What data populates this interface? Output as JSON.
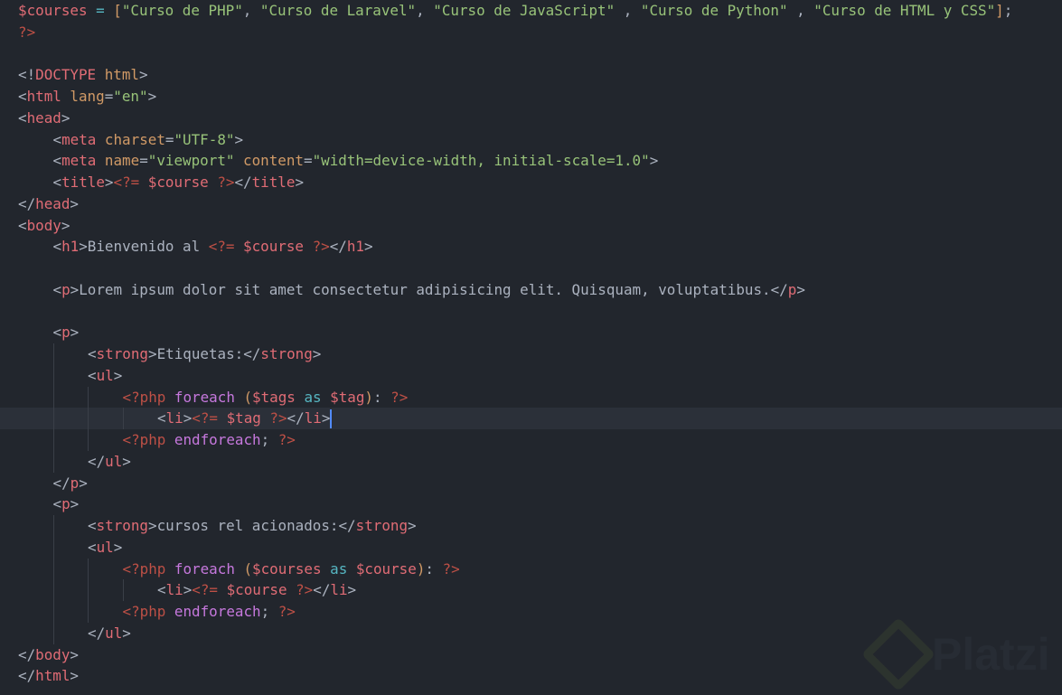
{
  "editor": {
    "active_line": 20,
    "lines": [
      {
        "indent": 0,
        "tokens": [
          [
            "v",
            "$courses"
          ],
          [
            "o",
            " = "
          ],
          [
            "b",
            "["
          ],
          [
            "s",
            "\"Curso de PHP\""
          ],
          [
            "n",
            ", "
          ],
          [
            "s",
            "\"Curso de Laravel\""
          ],
          [
            "n",
            ", "
          ],
          [
            "s",
            "\"Curso de JavaScript\""
          ],
          [
            "n",
            " , "
          ],
          [
            "s",
            "\"Curso de Python\""
          ],
          [
            "n",
            " , "
          ],
          [
            "s",
            "\"Curso de HTML y CSS\""
          ],
          [
            "b",
            "]"
          ],
          [
            "n",
            ";"
          ]
        ]
      },
      {
        "indent": 0,
        "tokens": [
          [
            "x",
            "?>"
          ]
        ]
      },
      {
        "indent": 0,
        "tokens": []
      },
      {
        "indent": 0,
        "tokens": [
          [
            "p",
            "<!"
          ],
          [
            "t",
            "DOCTYPE"
          ],
          [
            "a",
            " html"
          ],
          [
            "p",
            ">"
          ]
        ]
      },
      {
        "indent": 0,
        "tokens": [
          [
            "p",
            "<"
          ],
          [
            "t",
            "html"
          ],
          [
            "a",
            " lang"
          ],
          [
            "p",
            "="
          ],
          [
            "s",
            "\"en\""
          ],
          [
            "p",
            ">"
          ]
        ]
      },
      {
        "indent": 0,
        "tokens": [
          [
            "p",
            "<"
          ],
          [
            "t",
            "head"
          ],
          [
            "p",
            ">"
          ]
        ]
      },
      {
        "indent": 1,
        "tokens": [
          [
            "p",
            "<"
          ],
          [
            "t",
            "meta"
          ],
          [
            "a",
            " charset"
          ],
          [
            "p",
            "="
          ],
          [
            "s",
            "\"UTF-8\""
          ],
          [
            "p",
            ">"
          ]
        ]
      },
      {
        "indent": 1,
        "tokens": [
          [
            "p",
            "<"
          ],
          [
            "t",
            "meta"
          ],
          [
            "a",
            " name"
          ],
          [
            "p",
            "="
          ],
          [
            "s",
            "\"viewport\""
          ],
          [
            "a",
            " content"
          ],
          [
            "p",
            "="
          ],
          [
            "s",
            "\"width=device-width, initial-scale=1.0\""
          ],
          [
            "p",
            ">"
          ]
        ]
      },
      {
        "indent": 1,
        "tokens": [
          [
            "p",
            "<"
          ],
          [
            "t",
            "title"
          ],
          [
            "p",
            ">"
          ],
          [
            "x",
            "<?="
          ],
          [
            "v",
            " $course"
          ],
          [
            "x",
            " ?>"
          ],
          [
            "p",
            "</"
          ],
          [
            "t",
            "title"
          ],
          [
            "p",
            ">"
          ]
        ]
      },
      {
        "indent": 0,
        "tokens": [
          [
            "p",
            "</"
          ],
          [
            "t",
            "head"
          ],
          [
            "p",
            ">"
          ]
        ]
      },
      {
        "indent": 0,
        "tokens": [
          [
            "p",
            "<"
          ],
          [
            "t",
            "body"
          ],
          [
            "p",
            ">"
          ]
        ]
      },
      {
        "indent": 1,
        "tokens": [
          [
            "p",
            "<"
          ],
          [
            "t",
            "h1"
          ],
          [
            "p",
            ">"
          ],
          [
            "n",
            "Bienvenido al "
          ],
          [
            "x",
            "<?="
          ],
          [
            "v",
            " $course"
          ],
          [
            "x",
            " ?>"
          ],
          [
            "p",
            "</"
          ],
          [
            "t",
            "h1"
          ],
          [
            "p",
            ">"
          ]
        ]
      },
      {
        "indent": 1,
        "blank": true,
        "tokens": []
      },
      {
        "indent": 1,
        "tokens": [
          [
            "p",
            "<"
          ],
          [
            "t",
            "p"
          ],
          [
            "p",
            ">"
          ],
          [
            "n",
            "Lorem ipsum dolor sit amet consectetur adipisicing elit. Quisquam, voluptatibus."
          ],
          [
            "p",
            "</"
          ],
          [
            "t",
            "p"
          ],
          [
            "p",
            ">"
          ]
        ]
      },
      {
        "indent": 1,
        "blank": true,
        "tokens": []
      },
      {
        "indent": 1,
        "tokens": [
          [
            "p",
            "<"
          ],
          [
            "t",
            "p"
          ],
          [
            "p",
            ">"
          ]
        ]
      },
      {
        "indent": 2,
        "tokens": [
          [
            "p",
            "<"
          ],
          [
            "t",
            "strong"
          ],
          [
            "p",
            ">"
          ],
          [
            "n",
            "Etiquetas:"
          ],
          [
            "p",
            "</"
          ],
          [
            "t",
            "strong"
          ],
          [
            "p",
            ">"
          ]
        ]
      },
      {
        "indent": 2,
        "tokens": [
          [
            "p",
            "<"
          ],
          [
            "t",
            "ul"
          ],
          [
            "p",
            ">"
          ]
        ]
      },
      {
        "indent": 3,
        "tokens": [
          [
            "x",
            "<?php"
          ],
          [
            "k",
            " foreach"
          ],
          [
            "b",
            " ("
          ],
          [
            "v",
            "$tags"
          ],
          [
            "o",
            " as"
          ],
          [
            "v",
            " $tag"
          ],
          [
            "b",
            ")"
          ],
          [
            "n",
            ": "
          ],
          [
            "x",
            "?>"
          ]
        ]
      },
      {
        "indent": 4,
        "tokens": [
          [
            "p",
            "<"
          ],
          [
            "t",
            "li"
          ],
          [
            "p",
            ">"
          ],
          [
            "x",
            "<?="
          ],
          [
            "v",
            " $tag"
          ],
          [
            "x",
            " ?>"
          ],
          [
            "p",
            "</"
          ],
          [
            "t",
            "li"
          ],
          [
            "p",
            ">"
          ]
        ]
      },
      {
        "indent": 3,
        "tokens": [
          [
            "x",
            "<?php"
          ],
          [
            "k",
            " endforeach"
          ],
          [
            "n",
            "; "
          ],
          [
            "x",
            "?>"
          ]
        ]
      },
      {
        "indent": 2,
        "tokens": [
          [
            "p",
            "</"
          ],
          [
            "t",
            "ul"
          ],
          [
            "p",
            ">"
          ]
        ]
      },
      {
        "indent": 1,
        "tokens": [
          [
            "p",
            "</"
          ],
          [
            "t",
            "p"
          ],
          [
            "p",
            ">"
          ]
        ]
      },
      {
        "indent": 1,
        "tokens": [
          [
            "p",
            "<"
          ],
          [
            "t",
            "p"
          ],
          [
            "p",
            ">"
          ]
        ]
      },
      {
        "indent": 2,
        "tokens": [
          [
            "p",
            "<"
          ],
          [
            "t",
            "strong"
          ],
          [
            "p",
            ">"
          ],
          [
            "n",
            "cursos rel acionados:"
          ],
          [
            "p",
            "</"
          ],
          [
            "t",
            "strong"
          ],
          [
            "p",
            ">"
          ]
        ]
      },
      {
        "indent": 2,
        "tokens": [
          [
            "p",
            "<"
          ],
          [
            "t",
            "ul"
          ],
          [
            "p",
            ">"
          ]
        ]
      },
      {
        "indent": 3,
        "tokens": [
          [
            "x",
            "<?php"
          ],
          [
            "k",
            " foreach"
          ],
          [
            "b",
            " ("
          ],
          [
            "v",
            "$courses"
          ],
          [
            "o",
            " as"
          ],
          [
            "v",
            " $course"
          ],
          [
            "b",
            ")"
          ],
          [
            "n",
            ": "
          ],
          [
            "x",
            "?>"
          ]
        ]
      },
      {
        "indent": 4,
        "tokens": [
          [
            "p",
            "<"
          ],
          [
            "t",
            "li"
          ],
          [
            "p",
            ">"
          ],
          [
            "x",
            "<?="
          ],
          [
            "v",
            " $course"
          ],
          [
            "x",
            " ?>"
          ],
          [
            "p",
            "</"
          ],
          [
            "t",
            "li"
          ],
          [
            "p",
            ">"
          ]
        ]
      },
      {
        "indent": 3,
        "tokens": [
          [
            "x",
            "<?php"
          ],
          [
            "k",
            " endforeach"
          ],
          [
            "n",
            "; "
          ],
          [
            "x",
            "?>"
          ]
        ]
      },
      {
        "indent": 2,
        "tokens": [
          [
            "p",
            "</"
          ],
          [
            "t",
            "ul"
          ],
          [
            "p",
            ">"
          ]
        ]
      },
      {
        "indent": 0,
        "tokens": [
          [
            "p",
            "</"
          ],
          [
            "t",
            "body"
          ],
          [
            "p",
            ">"
          ]
        ]
      },
      {
        "indent": 0,
        "tokens": [
          [
            "p",
            "</"
          ],
          [
            "t",
            "html"
          ],
          [
            "p",
            ">"
          ]
        ]
      }
    ]
  },
  "watermark": {
    "brand": "Platzi"
  }
}
